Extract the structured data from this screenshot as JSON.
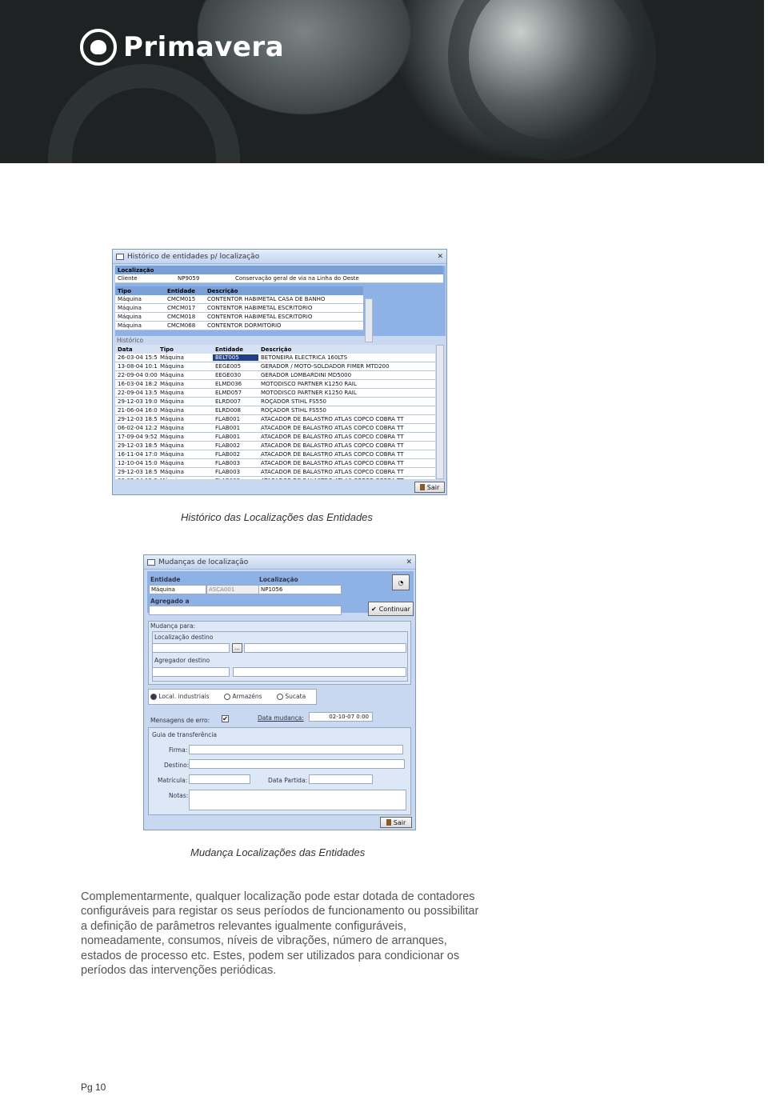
{
  "brand": {
    "name": "Primavera"
  },
  "win1": {
    "title": "Histórico de entidades p/ localização",
    "close": "✕",
    "loc_label": "Localização",
    "loc_row": [
      "Cliente",
      "NP9059",
      "Conservação geral de via na Linha do Oeste"
    ],
    "top_headers": [
      "Tipo",
      "Entidade",
      "Descrição"
    ],
    "top_rows": [
      [
        "Máquina",
        "CMCM015",
        "CONTENTOR HABIMETAL CASA DE BANHO"
      ],
      [
        "Máquina",
        "CMCM017",
        "CONTENTOR HABIMETAL ESCRITÓRIO"
      ],
      [
        "Máquina",
        "CMCM018",
        "CONTENTOR HABIMETAL ESCRITÓRIO"
      ],
      [
        "Máquina",
        "CMCM068",
        "CONTENTOR DORMITÓRIO"
      ]
    ],
    "hist_label": "Histórico",
    "hist_headers": [
      "Data",
      "Tipo",
      "Entidade",
      "Descrição"
    ],
    "hist_rows": [
      [
        "26-03-04 15:54",
        "Máquina",
        "BELT005",
        "BETONEIRA ELÉCTRICA 160LTS"
      ],
      [
        "13-08-04 10:16",
        "Máquina",
        "EEGE005",
        "GERADOR / MOTO-SOLDADOR FIMER MTD200"
      ],
      [
        "22-09-04 0:00",
        "Máquina",
        "EEGE030",
        "GERADOR LOMBARDINI MD5000"
      ],
      [
        "16-03-04 18:27",
        "Máquina",
        "ELMD036",
        "MOTODISCO PARTNER K1250 RAIL"
      ],
      [
        "22-09-04 13:51",
        "Máquina",
        "ELMD057",
        "MOTODISCO PARTNER K1250 RAIL"
      ],
      [
        "29-12-03 19:07",
        "Máquina",
        "ELRD007",
        "ROÇADOR STIHL FS550"
      ],
      [
        "21-06-04 16:02",
        "Máquina",
        "ELRD008",
        "ROÇADOR STIHL FS550"
      ],
      [
        "29-12-03 18:50",
        "Máquina",
        "FLAB001",
        "ATACADOR DE BALASTRO ATLAS COPCO COBRA TT"
      ],
      [
        "06-02-04 12:26",
        "Máquina",
        "FLAB001",
        "ATACADOR DE BALASTRO ATLAS COPCO COBRA TT"
      ],
      [
        "17-09-04 9:52",
        "Máquina",
        "FLAB001",
        "ATACADOR DE BALASTRO ATLAS COPCO COBRA TT"
      ],
      [
        "29-12-03 18:50",
        "Máquina",
        "FLAB002",
        "ATACADOR DE BALASTRO ATLAS COPCO COBRA TT"
      ],
      [
        "16-11-04 17:03",
        "Máquina",
        "FLAB002",
        "ATACADOR DE BALASTRO ATLAS COPCO COBRA TT"
      ],
      [
        "12-10-04 15:07",
        "Máquina",
        "FLAB003",
        "ATACADOR DE BALASTRO ATLAS COPCO COBRA TT"
      ],
      [
        "29-12-03 18:50",
        "Máquina",
        "FLAB003",
        "ATACADOR DE BALASTRO ATLAS COPCO COBRA TT"
      ],
      [
        "06-02-04 12:26",
        "Máquina",
        "FLAB003",
        "ATACADOR DE BALASTRO ATLAS COPCO COBRA TT"
      ]
    ],
    "exit": "Sair"
  },
  "caption1": "Histórico das Localizações das Entidades",
  "win2": {
    "title": "Mudanças de localização",
    "close": "✕",
    "entidade_label": "Entidade",
    "localizacao_label": "Localização",
    "entidade_tipo": "Máquina",
    "entidade_code": "ASCA001",
    "localizacao_value": "NP1056",
    "agregado_label": "Agregado a",
    "continuar": "Continuar",
    "mudanca_para": "Mudança para:",
    "loc_destino": "Localização destino",
    "agregador_destino": "Agregador destino",
    "ellipsis": "...",
    "radios": [
      "Local. industriais",
      "Armazéns",
      "Sucata"
    ],
    "mensagens": "Mensagens de erro:",
    "data_mudanca_label": "Data mudança:",
    "data_mudanca": "02-10-07 0:00",
    "guia": "Guia de transferência",
    "firma": "Firma:",
    "destino": "Destino:",
    "matricula": "Matrícula:",
    "data_partida": "Data Partida:",
    "notas": "Notas:",
    "exit": "Sair"
  },
  "caption2": "Mudança Localizações das Entidades",
  "paragraph": [
    "Complementarmente, qualquer localização pode estar dotada de contadores",
    "configuráveis para registar os seus períodos de funcionamento ou possibilitar",
    "a definição de parâmetros relevantes igualmente configuráveis,",
    "nomeadamente, consumos, níveis de vibrações, número de arranques,",
    "estados de processo etc. Estes, podem ser utilizados para condicionar os",
    "períodos das intervenções periódicas."
  ],
  "page": "Pg 10"
}
